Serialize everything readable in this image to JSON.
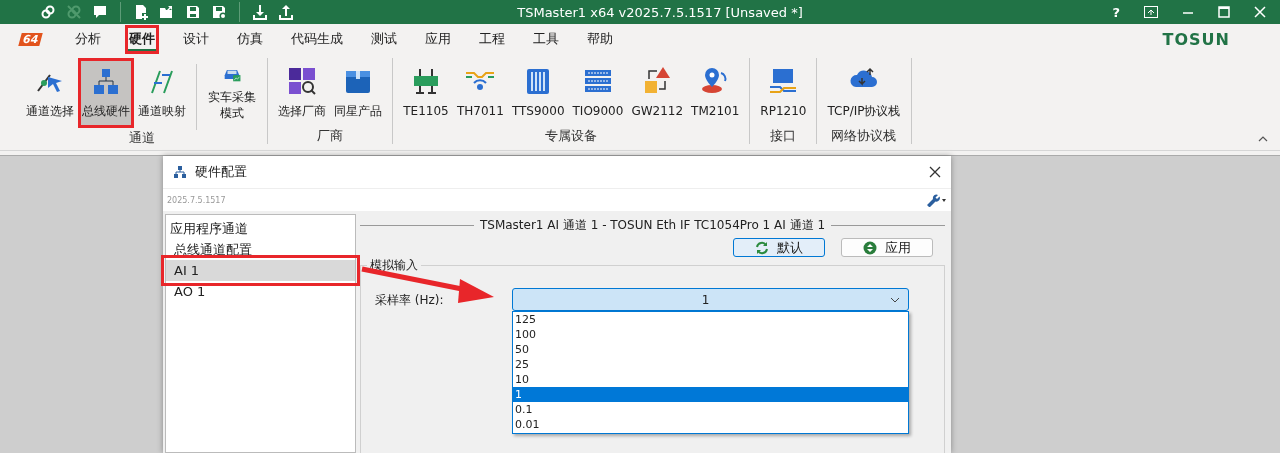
{
  "title_bar": {
    "title": "TSMaster1 x64 v2025.7.5.1517 [Unsaved *]",
    "help": "?",
    "quick_access": [
      {
        "disabled": false
      },
      {
        "disabled": true
      },
      {
        "disabled": false
      },
      {
        "disabled": false
      },
      {
        "disabled": false
      },
      {
        "disabled": false
      },
      {
        "disabled": false
      },
      {
        "disabled": false
      },
      {
        "disabled": false
      }
    ]
  },
  "menu": {
    "logo_text": "64",
    "brand": "TOSUN",
    "tabs": [
      {
        "label": "分析",
        "selected": false,
        "highlighted": false
      },
      {
        "label": "硬件",
        "selected": true,
        "highlighted": true
      },
      {
        "label": "设计",
        "selected": false,
        "highlighted": false
      },
      {
        "label": "仿真",
        "selected": false,
        "highlighted": false
      },
      {
        "label": "代码生成",
        "selected": false,
        "highlighted": false
      },
      {
        "label": "测试",
        "selected": false,
        "highlighted": false
      },
      {
        "label": "应用",
        "selected": false,
        "highlighted": false
      },
      {
        "label": "工程",
        "selected": false,
        "highlighted": false
      },
      {
        "label": "工具",
        "selected": false,
        "highlighted": false
      },
      {
        "label": "帮助",
        "selected": false,
        "highlighted": false
      }
    ]
  },
  "ribbon": {
    "groups": [
      {
        "label": "通道",
        "buttons": [
          {
            "label": "通道选择",
            "selected": false,
            "highlighted": false
          },
          {
            "label": "总线硬件",
            "selected": true,
            "highlighted": true
          },
          {
            "label": "通道映射",
            "selected": false,
            "highlighted": false
          },
          {
            "label": "实车采集模式",
            "selected": false,
            "highlighted": false
          }
        ]
      },
      {
        "label": "厂商",
        "buttons": [
          {
            "label": "选择厂商",
            "selected": false,
            "highlighted": false
          },
          {
            "label": "同星产品",
            "selected": false,
            "highlighted": false
          }
        ]
      },
      {
        "label": "专属设备",
        "buttons": [
          {
            "label": "TE1105",
            "selected": false,
            "highlighted": false
          },
          {
            "label": "TH7011",
            "selected": false,
            "highlighted": false
          },
          {
            "label": "TTS9000",
            "selected": false,
            "highlighted": false
          },
          {
            "label": "TIO9000",
            "selected": false,
            "highlighted": false
          },
          {
            "label": "GW2112",
            "selected": false,
            "highlighted": false
          },
          {
            "label": "TM2101",
            "selected": false,
            "highlighted": false
          }
        ]
      },
      {
        "label": "接口",
        "buttons": [
          {
            "label": "RP1210",
            "selected": false,
            "highlighted": false
          }
        ]
      },
      {
        "label": "网络协议栈",
        "buttons": [
          {
            "label": "TCP/IP协议栈",
            "selected": false,
            "highlighted": false
          }
        ]
      }
    ]
  },
  "dialog": {
    "title": "硬件配置",
    "version": "2025.7.5.1517",
    "tree": [
      {
        "label": "应用程序通道",
        "selected": false,
        "highlighted": false,
        "children": [
          {
            "label": "总线通道配置",
            "selected": false,
            "highlighted": false
          },
          {
            "label": "AI 1",
            "selected": true,
            "highlighted": true
          },
          {
            "label": "AO 1",
            "selected": false,
            "highlighted": false
          }
        ]
      }
    ],
    "panel_title": "TSMaster1 AI 通道 1 - TOSUN Eth IF TC1054Pro 1 AI 通道 1",
    "buttons": [
      {
        "label": "默认",
        "focused": true
      },
      {
        "label": "应用",
        "focused": false
      }
    ],
    "group": {
      "title": "模拟输入",
      "fields": [
        {
          "label": "采样率 (Hz):",
          "value": "1",
          "expanded": true,
          "options": [
            {
              "label": "125",
              "selected": false
            },
            {
              "label": "100",
              "selected": false
            },
            {
              "label": "50",
              "selected": false
            },
            {
              "label": "25",
              "selected": false
            },
            {
              "label": "10",
              "selected": false
            },
            {
              "label": "1",
              "selected": true
            },
            {
              "label": "0.1",
              "selected": false
            },
            {
              "label": "0.01",
              "selected": false
            }
          ]
        }
      ]
    }
  },
  "annotation_arrow": true
}
